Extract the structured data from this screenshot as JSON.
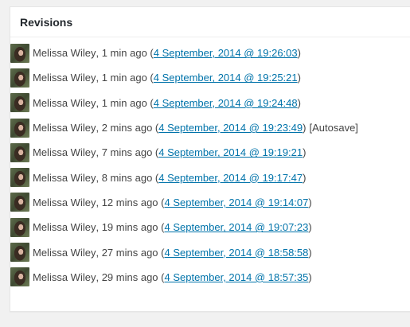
{
  "panel": {
    "title": "Revisions"
  },
  "revisions": [
    {
      "author": "Melissa Wiley",
      "ago": "1 min ago",
      "date": "4 September, 2014 @ 19:26:03",
      "note": ""
    },
    {
      "author": "Melissa Wiley",
      "ago": "1 min ago",
      "date": "4 September, 2014 @ 19:25:21",
      "note": ""
    },
    {
      "author": "Melissa Wiley",
      "ago": "1 min ago",
      "date": "4 September, 2014 @ 19:24:48",
      "note": ""
    },
    {
      "author": "Melissa Wiley",
      "ago": "2 mins ago",
      "date": "4 September, 2014 @ 19:23:49",
      "note": "[Autosave]"
    },
    {
      "author": "Melissa Wiley",
      "ago": "7 mins ago",
      "date": "4 September, 2014 @ 19:19:21",
      "note": ""
    },
    {
      "author": "Melissa Wiley",
      "ago": "8 mins ago",
      "date": "4 September, 2014 @ 19:17:47",
      "note": ""
    },
    {
      "author": "Melissa Wiley",
      "ago": "12 mins ago",
      "date": "4 September, 2014 @ 19:14:07",
      "note": ""
    },
    {
      "author": "Melissa Wiley",
      "ago": "19 mins ago",
      "date": "4 September, 2014 @ 19:07:23",
      "note": ""
    },
    {
      "author": "Melissa Wiley",
      "ago": "27 mins ago",
      "date": "4 September, 2014 @ 18:58:58",
      "note": ""
    },
    {
      "author": "Melissa Wiley",
      "ago": "29 mins ago",
      "date": "4 September, 2014 @ 18:57:35",
      "note": ""
    }
  ],
  "colors": {
    "link": "#0073aa",
    "text": "#444444",
    "background": "#f1f1f1",
    "panel": "#ffffff"
  },
  "icons": {
    "avatar": "user-avatar-photo"
  }
}
